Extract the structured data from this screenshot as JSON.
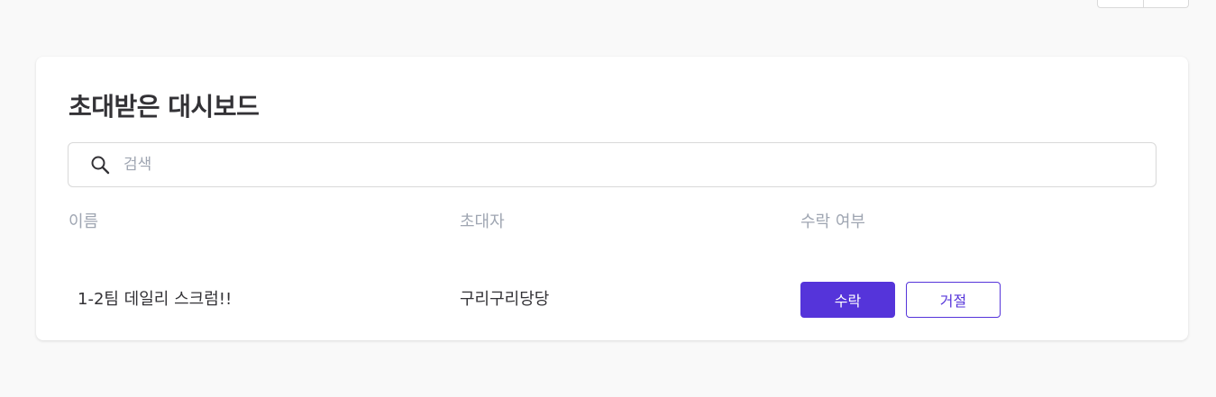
{
  "card": {
    "title": "초대받은 대시보드"
  },
  "search": {
    "placeholder": "검색",
    "value": ""
  },
  "table": {
    "columns": [
      "이름",
      "초대자",
      "수락 여부"
    ],
    "rows": [
      {
        "name": "1-2팀 데일리 스크럼!!",
        "inviter": "구리구리당당",
        "accept_label": "수락",
        "reject_label": "거절"
      }
    ]
  },
  "colors": {
    "accent": "#5534da",
    "text_primary": "#333236",
    "text_muted": "#9fa6b2",
    "background": "#f9f9f9",
    "border": "#d9d9d9"
  },
  "icons": {
    "search": "search-icon"
  }
}
